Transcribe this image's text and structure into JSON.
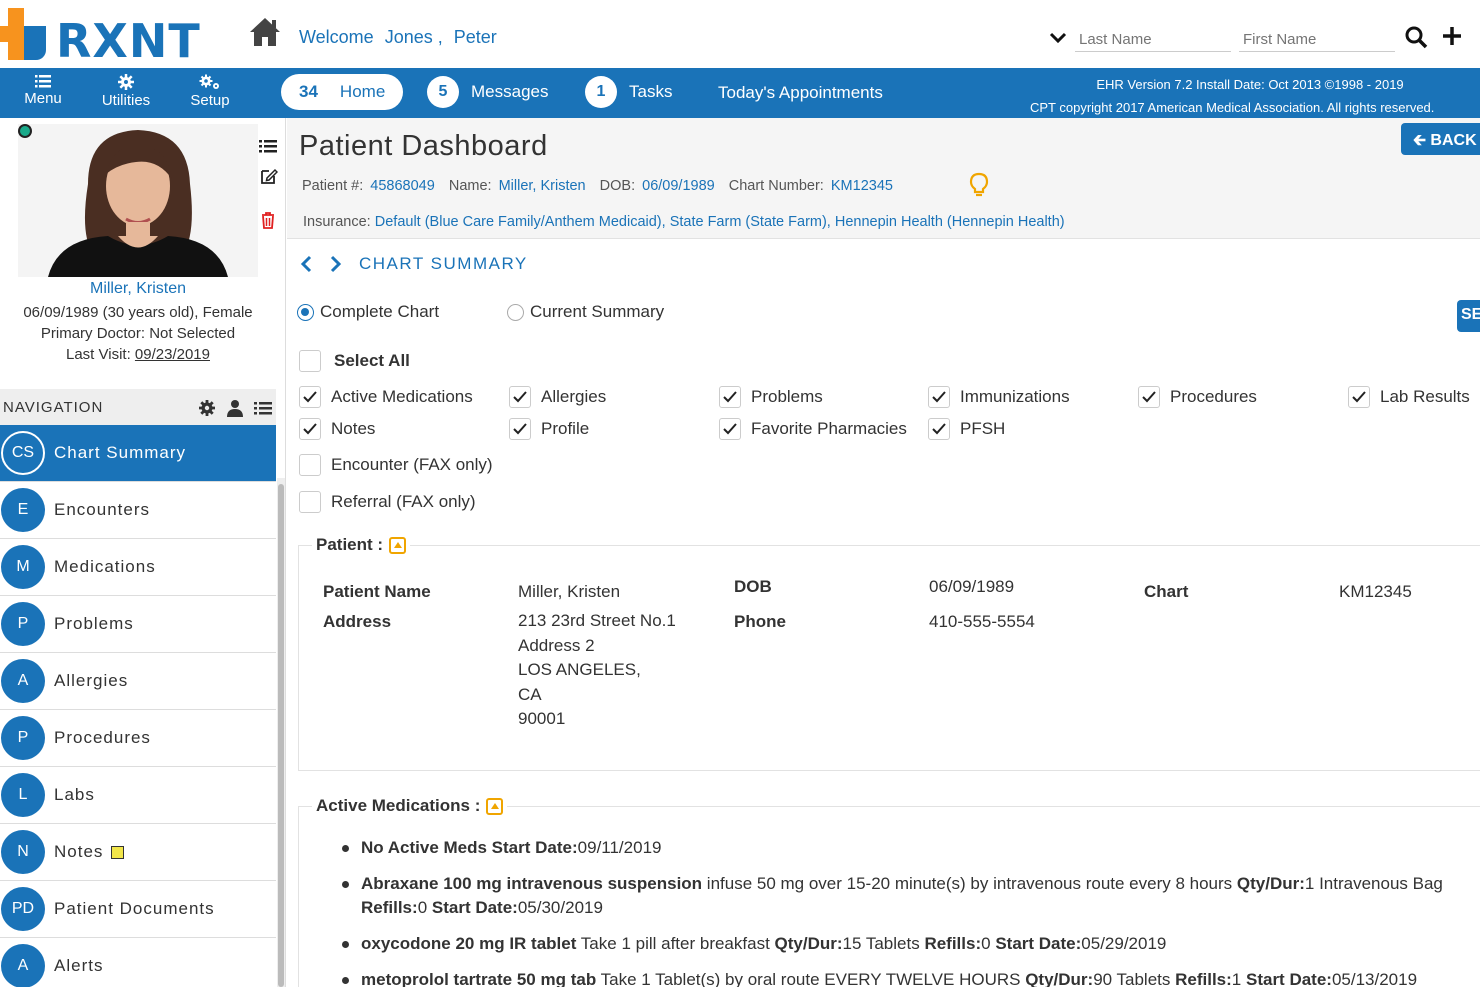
{
  "brand": {
    "name": "RXNT"
  },
  "header": {
    "welcome": "Welcome",
    "user_last": "Jones ,",
    "user_first": "Peter",
    "search": {
      "last_placeholder": "Last Name",
      "first_placeholder": "First Name"
    }
  },
  "toolbar": {
    "menu": "Menu",
    "utilities": "Utilities",
    "setup": "Setup",
    "home": {
      "count": "34",
      "label": "Home"
    },
    "messages": {
      "count": "5",
      "label": "Messages"
    },
    "tasks": {
      "count": "1",
      "label": "Tasks"
    },
    "appointments": "Today's Appointments",
    "version_line1": "EHR Version 7.2 Install Date: Oct 2013 ©1998 - 2019",
    "version_line2": "CPT copyright 2017 American Medical Association. All rights reserved."
  },
  "patient_card": {
    "name": "Miller, Kristen",
    "dob_line": "06/09/1989 (30 years old), Female",
    "doctor_line": "Primary Doctor: Not Selected",
    "last_visit_label": "Last Visit:",
    "last_visit": "09/23/2019"
  },
  "navigation": {
    "title": "NAVIGATION",
    "items": [
      {
        "abbr": "CS",
        "label": "Chart Summary"
      },
      {
        "abbr": "E",
        "label": "Encounters"
      },
      {
        "abbr": "M",
        "label": "Medications"
      },
      {
        "abbr": "P",
        "label": "Problems"
      },
      {
        "abbr": "A",
        "label": "Allergies"
      },
      {
        "abbr": "P",
        "label": "Procedures"
      },
      {
        "abbr": "L",
        "label": "Labs"
      },
      {
        "abbr": "N",
        "label": "Notes"
      },
      {
        "abbr": "PD",
        "label": "Patient Documents"
      },
      {
        "abbr": "A",
        "label": "Alerts"
      }
    ]
  },
  "dashboard": {
    "title": "Patient Dashboard",
    "back": "BACK",
    "patient_num_label": "Patient #:",
    "patient_num": "45868049",
    "name_label": "Name:",
    "name": "Miller, Kristen",
    "dob_label": "DOB:",
    "dob": "06/09/1989",
    "chart_label": "Chart Number:",
    "chart": "KM12345",
    "insurance_label": "Insurance:",
    "insurance": "Default (Blue Care Family/Anthem Medicaid), State Farm (State Farm), Hennepin Health (Hennepin Health)"
  },
  "chart_summary": {
    "heading": "CHART SUMMARY",
    "radio_complete": "Complete Chart",
    "radio_current": "Current Summary",
    "send": "SEND",
    "select_all": "Select All",
    "options": {
      "active_medications": "Active Medications",
      "allergies": "Allergies",
      "problems": "Problems",
      "immunizations": "Immunizations",
      "procedures": "Procedures",
      "lab_results": "Lab Results",
      "notes": "Notes",
      "profile": "Profile",
      "favorite_pharmacies": "Favorite Pharmacies",
      "pfsh": "PFSH",
      "encounter_fax": "Encounter (FAX only)",
      "referral_fax": "Referral (FAX only)"
    }
  },
  "patient_section": {
    "title": "Patient :",
    "name_label": "Patient Name",
    "name": "Miller, Kristen",
    "address_label": "Address",
    "address": [
      "213 23rd Street No.1",
      "Address 2",
      "LOS ANGELES,",
      "CA",
      "90001"
    ],
    "dob_label": "DOB",
    "dob": "06/09/1989",
    "phone_label": "Phone",
    "phone": "410-555-5554",
    "chart_label": "Chart",
    "chart": "KM12345"
  },
  "meds_section": {
    "title": "Active Medications :",
    "m1_name": "No Active Meds Start Date:",
    "m1_date": "09/11/2019",
    "m2_name": "Abraxane 100 mg intravenous suspension",
    "m2_sig": " infuse 50 mg over 15-20 minute(s) by intravenous route every 8 hours ",
    "m2_qty_label": "Qty/Dur:",
    "m2_qty": "1 Intravenous Bag",
    "m2_refills_label": "Refills:",
    "m2_refills": "0 ",
    "m2_start_label": "Start Date:",
    "m2_start": "05/30/2019",
    "m3_name": "oxycodone 20 mg IR tablet",
    "m3_sig": " Take 1 pill after breakfast ",
    "m3_qty_label": "Qty/Dur:",
    "m3_qty": "15 Tablets ",
    "m3_refills_label": "Refills:",
    "m3_refills": "0 ",
    "m3_start_label": "Start Date:",
    "m3_start": "05/29/2019",
    "m4_name": "metoprolol tartrate 50 mg tab",
    "m4_sig": " Take 1 Tablet(s) by oral route EVERY TWELVE HOURS ",
    "m4_qty_label": "Qty/Dur:",
    "m4_qty": "90 Tablets ",
    "m4_refills_label": "Refills:",
    "m4_refills": "1 ",
    "m4_start_label": "Start Date:",
    "m4_start": "05/13/2019"
  },
  "colors": {
    "brand_blue": "#1a73b8",
    "brand_orange": "#f7931e",
    "accent_yellow": "#f0a500"
  }
}
